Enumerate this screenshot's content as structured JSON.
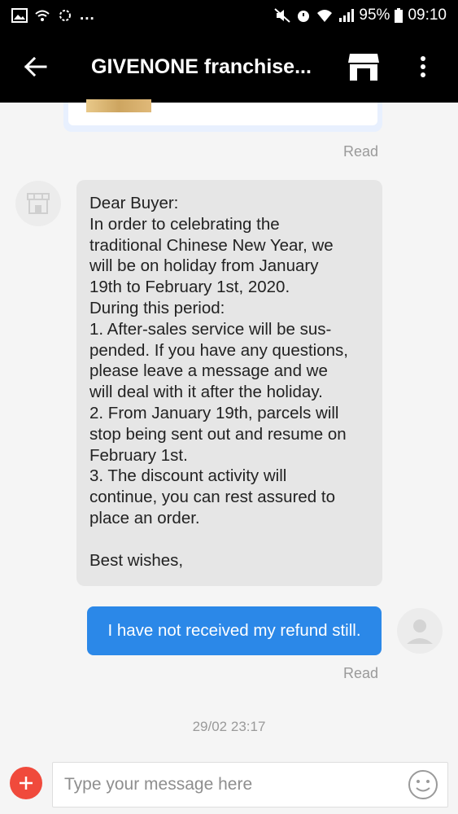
{
  "status_bar": {
    "overflow_indicator": "...",
    "battery_percent": "95%",
    "time": "09:10"
  },
  "app_bar": {
    "title": "GIVENONE franchise..."
  },
  "messages": [
    {
      "type": "incoming",
      "lines": [
        "Dear Buyer:",
        "In order to celebrating the",
        "traditional Chinese New Year, we",
        "will be on holiday from January",
        "19th to February 1st, 2020.",
        "During this period:",
        "1. After-sales service will be sus-",
        "pended. If you have any questions,",
        "please leave a message and we",
        "will deal with it after the holiday.",
        "2. From January 19th, parcels will",
        "stop being sent out and resume on",
        "February 1st.",
        "3. The discount activity will",
        "continue, you can rest assured to",
        "place an order.",
        "",
        "Best wishes,"
      ]
    },
    {
      "type": "outgoing",
      "text": "I have not received my refund still.",
      "status": "Read"
    }
  ],
  "earlier_status": "Read",
  "timestamp": "29/02 23:17",
  "composer": {
    "placeholder": "Type your message here"
  },
  "colors": {
    "accent_blue": "#2b88e8",
    "add_red": "#f04a3c",
    "incoming_bg": "#e6e6e6"
  }
}
